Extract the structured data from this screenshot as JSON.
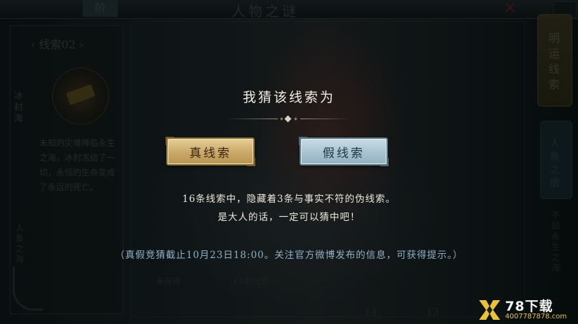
{
  "background": {
    "stage_tab": "阶",
    "scene_title": "人物之谜",
    "clue_header": "‹ 线索02 ›",
    "clue_side_label": "冰封海",
    "clue_text": "未知的灾难降临永生之海，冰封冻结了一切，永恒的生命变成了永远的死亡。",
    "left_side_label": "人鱼之海",
    "right_tab_label": "明运线索",
    "right_tab2_label": "人鱼之情",
    "right_side_text": "不知永生之海",
    "row_label_1": "未获得",
    "row_label_2": "14条线索",
    "num_1": "14",
    "num_2": "13"
  },
  "dialog": {
    "title": "我猜该线索为",
    "true_button": "真线索",
    "false_button": "假线索",
    "info_line_1": "16条线索中，隐藏着3条与事实不符的伪线索。",
    "info_line_2": "是大人的话，一定可以猜中吧！",
    "notice": "（真假竞猜截止10月23日18:00。关注官方微博发布的信息，可获得提示。）"
  },
  "watermark": {
    "title": "78下载",
    "url": "4007787878.com"
  },
  "colors": {
    "true_button": "#c9a867",
    "false_button": "#a8c3d0",
    "notice_text": "#8fb1c4",
    "watermark_url": "#e8c23a"
  }
}
